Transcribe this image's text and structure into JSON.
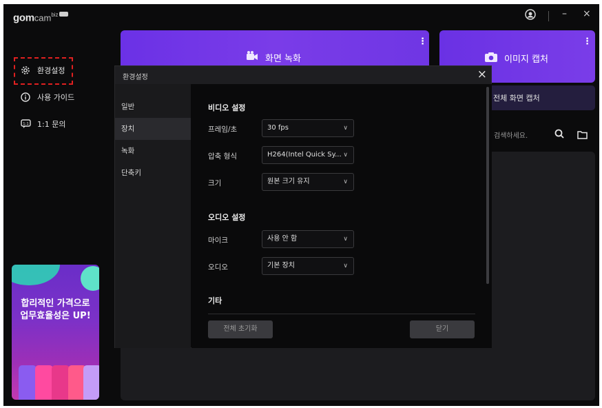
{
  "app": {
    "logo_main": "gom",
    "logo_sub": "cam",
    "logo_biz": "biz"
  },
  "titlebar": {
    "minimize": "–",
    "close": "×"
  },
  "nav": [
    {
      "label": "환경설정",
      "icon": "gear-icon"
    },
    {
      "label": "사용 가이드",
      "icon": "info-icon"
    },
    {
      "label": "1:1 문의",
      "icon": "chat-icon"
    }
  ],
  "promo": {
    "line1": "합리적인 가격으로",
    "line2": "업무효율성은 UP!"
  },
  "actions": {
    "record_label": "화면 녹화",
    "capture_label": "이미지 캡처",
    "fullscreen_capture_label": "전체 화면 캡처",
    "search_placeholder": "검색하세요."
  },
  "dialog": {
    "title": "환경설정",
    "close": "×",
    "sidebar": [
      "일반",
      "장치",
      "녹화",
      "단축키"
    ],
    "active_tab": "장치",
    "video_section": "비디오 설정",
    "audio_section": "오디오 설정",
    "etc_section": "기타",
    "rows": {
      "framerate_label": "프레임/초",
      "framerate_value": "30 fps",
      "codec_label": "압축 형식",
      "codec_value": "H264(Intel Quick Sy...",
      "size_label": "크기",
      "size_value": "원본 크기 유지",
      "mic_label": "마이크",
      "mic_value": "사용 안 함",
      "audio_label": "오디오",
      "audio_value": "기본 장치"
    },
    "reset_button": "전체 초기화",
    "close_button": "닫기"
  },
  "colors": {
    "accent_purple": "#6b31e6",
    "highlight_red": "#e02020",
    "background": "#0b0b0c"
  }
}
